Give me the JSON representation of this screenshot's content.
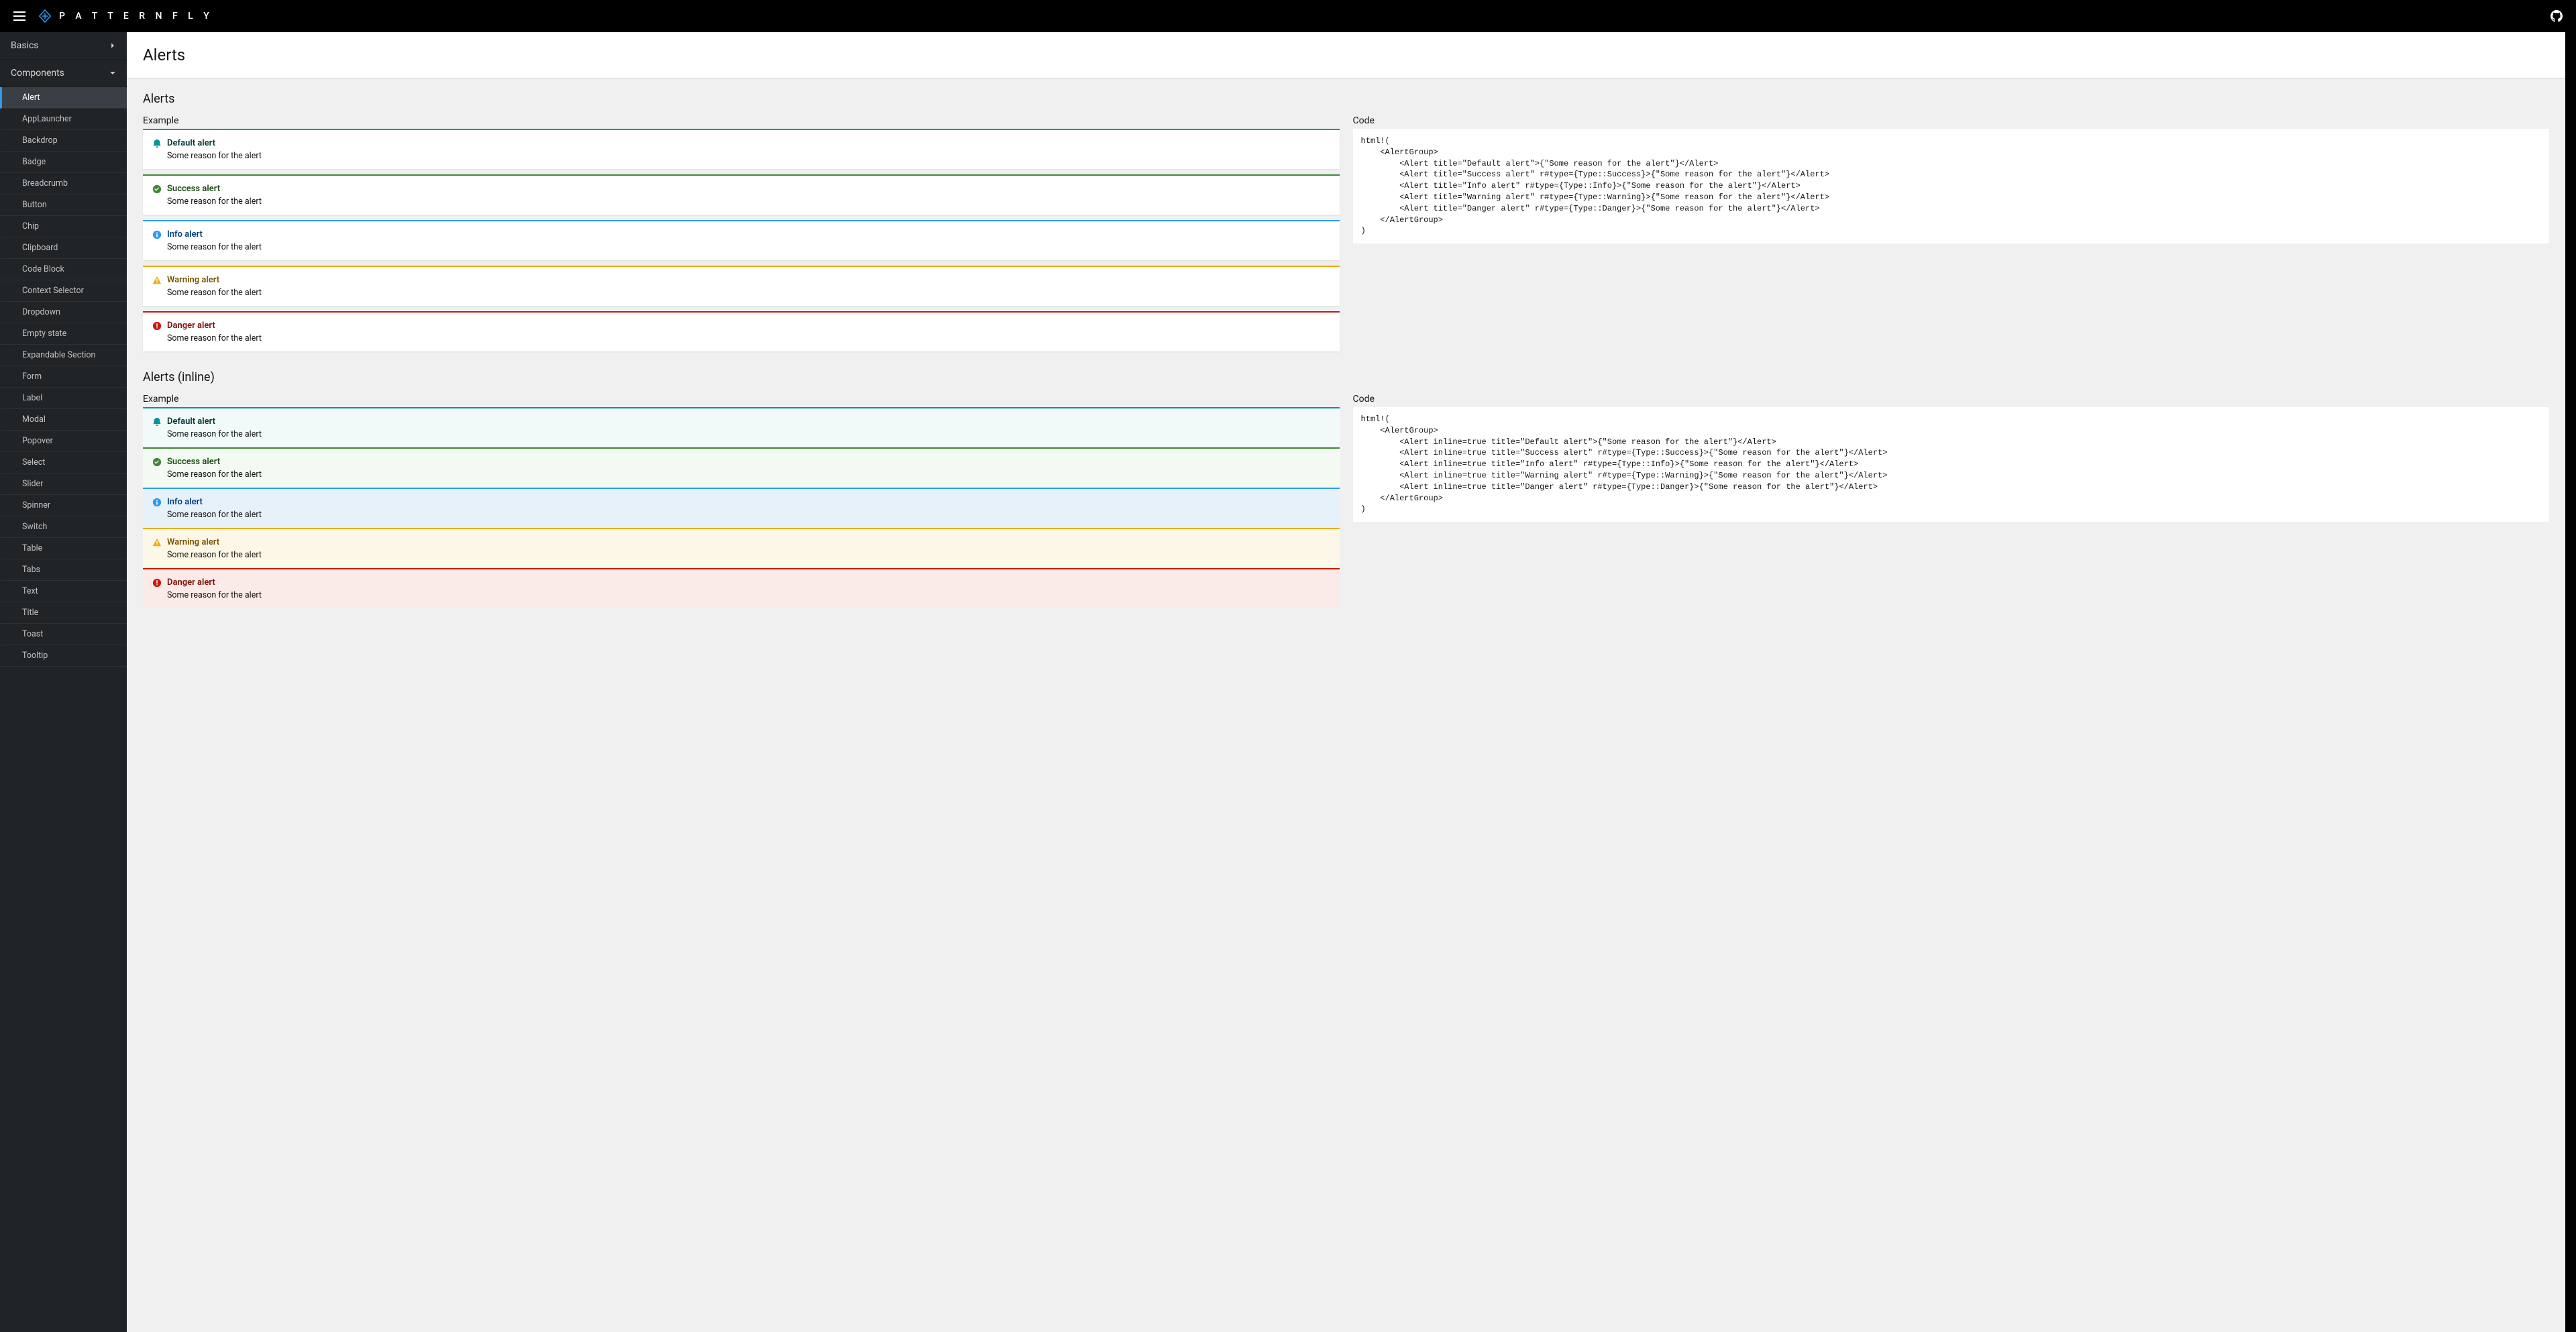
{
  "brand": "P A T T E R N F L Y",
  "sidebar": {
    "groups": [
      {
        "label": "Basics",
        "expanded": false
      },
      {
        "label": "Components",
        "expanded": true
      }
    ],
    "items": [
      "Alert",
      "AppLauncher",
      "Backdrop",
      "Badge",
      "Breadcrumb",
      "Button",
      "Chip",
      "Clipboard",
      "Code Block",
      "Context Selector",
      "Dropdown",
      "Empty state",
      "Expandable Section",
      "Form",
      "Label",
      "Modal",
      "Popover",
      "Select",
      "Slider",
      "Spinner",
      "Switch",
      "Table",
      "Tabs",
      "Text",
      "Title",
      "Toast",
      "Tooltip"
    ],
    "active": "Alert"
  },
  "page_title": "Alerts",
  "sections": [
    {
      "title": "Alerts",
      "example_label": "Example",
      "code_label": "Code",
      "inline": false,
      "alerts": [
        {
          "type": "default",
          "title": "Default alert",
          "body": "Some reason for the alert"
        },
        {
          "type": "success",
          "title": "Success alert",
          "body": "Some reason for the alert"
        },
        {
          "type": "info",
          "title": "Info alert",
          "body": "Some reason for the alert"
        },
        {
          "type": "warning",
          "title": "Warning alert",
          "body": "Some reason for the alert"
        },
        {
          "type": "danger",
          "title": "Danger alert",
          "body": "Some reason for the alert"
        }
      ],
      "code": "html!(\n    <AlertGroup>\n        <Alert title=\"Default alert\">{\"Some reason for the alert\"}</Alert>\n        <Alert title=\"Success alert\" r#type={Type::Success}>{\"Some reason for the alert\"}</Alert>\n        <Alert title=\"Info alert\" r#type={Type::Info}>{\"Some reason for the alert\"}</Alert>\n        <Alert title=\"Warning alert\" r#type={Type::Warning}>{\"Some reason for the alert\"}</Alert>\n        <Alert title=\"Danger alert\" r#type={Type::Danger}>{\"Some reason for the alert\"}</Alert>\n    </AlertGroup>\n)"
    },
    {
      "title": "Alerts (inline)",
      "example_label": "Example",
      "code_label": "Code",
      "inline": true,
      "alerts": [
        {
          "type": "default",
          "title": "Default alert",
          "body": "Some reason for the alert"
        },
        {
          "type": "success",
          "title": "Success alert",
          "body": "Some reason for the alert"
        },
        {
          "type": "info",
          "title": "Info alert",
          "body": "Some reason for the alert"
        },
        {
          "type": "warning",
          "title": "Warning alert",
          "body": "Some reason for the alert"
        },
        {
          "type": "danger",
          "title": "Danger alert",
          "body": "Some reason for the alert"
        }
      ],
      "code": "html!(\n    <AlertGroup>\n        <Alert inline=true title=\"Default alert\">{\"Some reason for the alert\"}</Alert>\n        <Alert inline=true title=\"Success alert\" r#type={Type::Success}>{\"Some reason for the alert\"}</Alert>\n        <Alert inline=true title=\"Info alert\" r#type={Type::Info}>{\"Some reason for the alert\"}</Alert>\n        <Alert inline=true title=\"Warning alert\" r#type={Type::Warning}>{\"Some reason for the alert\"}</Alert>\n        <Alert inline=true title=\"Danger alert\" r#type={Type::Danger}>{\"Some reason for the alert\"}</Alert>\n    </AlertGroup>\n)"
    }
  ]
}
